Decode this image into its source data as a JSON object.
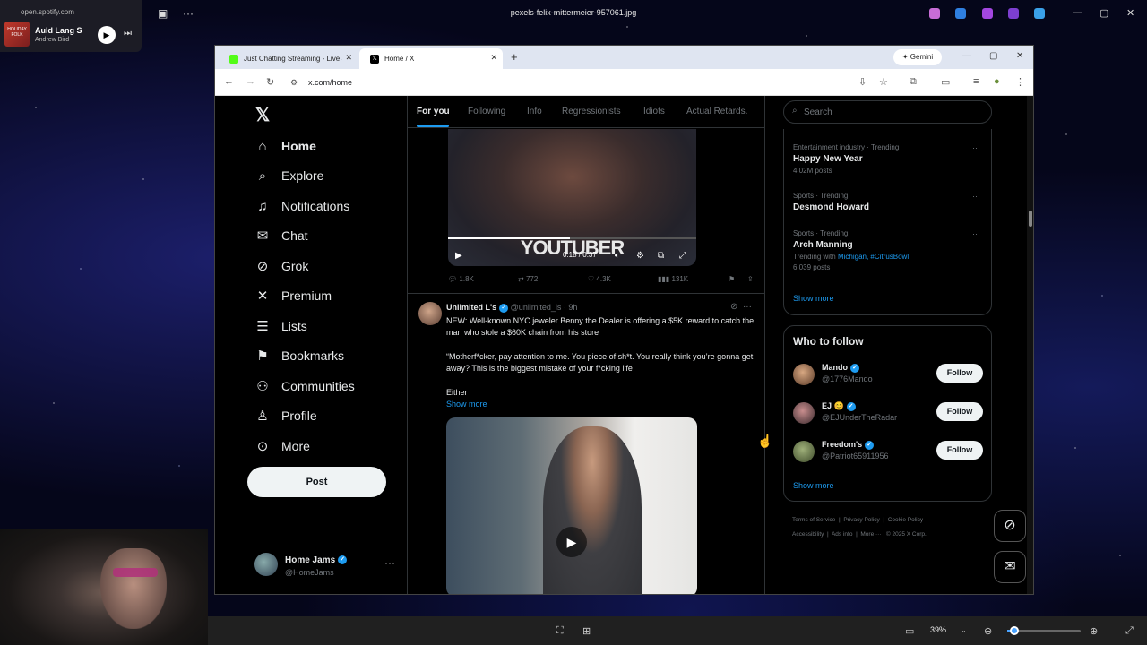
{
  "viewer": {
    "file_name": "pexels-felix-mittermeier-957061.jpg",
    "zoom": "39%"
  },
  "media_widget": {
    "source": "open.spotify.com",
    "album_art_text": "HOLIDAY FOLK",
    "title": "Auld Lang S",
    "artist": "Andrew Bird"
  },
  "browser": {
    "tabs": [
      {
        "label": "Just Chatting Streaming - Live S",
        "icon": "kick-icon",
        "color": "#53fc18"
      },
      {
        "label": "Home / X",
        "icon": "x-icon",
        "color": "#000000"
      }
    ],
    "gemini_label": "Gemini",
    "url": "x.com/home"
  },
  "x": {
    "nav": [
      {
        "id": "home",
        "label": "Home",
        "icon": "home-icon"
      },
      {
        "id": "explore",
        "label": "Explore",
        "icon": "search-icon"
      },
      {
        "id": "notifications",
        "label": "Notifications",
        "icon": "bell-icon"
      },
      {
        "id": "chat",
        "label": "Chat",
        "icon": "mail-icon"
      },
      {
        "id": "grok",
        "label": "Grok",
        "icon": "grok-icon"
      },
      {
        "id": "premium",
        "label": "Premium",
        "icon": "x-premium-icon"
      },
      {
        "id": "lists",
        "label": "Lists",
        "icon": "list-icon"
      },
      {
        "id": "bookmarks",
        "label": "Bookmarks",
        "icon": "bookmark-icon"
      },
      {
        "id": "communities",
        "label": "Communities",
        "icon": "people-icon"
      },
      {
        "id": "profile",
        "label": "Profile",
        "icon": "person-icon"
      },
      {
        "id": "more",
        "label": "More",
        "icon": "more-circle-icon"
      }
    ],
    "post_label": "Post",
    "account": {
      "name": "Home Jams",
      "handle": "@HomeJams"
    },
    "feed_tabs": [
      "For you",
      "Following",
      "Info",
      "Regressionists",
      "Idiots",
      "Actual Retards."
    ],
    "video1": {
      "caption": "YOUTUBER",
      "time": "0:18 / 0:37"
    },
    "post1_actions": {
      "replies": "1.8K",
      "reposts": "772",
      "likes": "4.3K",
      "views": "131K"
    },
    "post2": {
      "name": "Unlimited L's",
      "handle": "@unlimited_ls",
      "time": "· 9h",
      "text1": "NEW: Well-known NYC jeweler Benny the Dealer is offering a $5K reward to catch the man who stole a $60K chain from his store",
      "text2": "“Motherf*cker, pay attention to me. You piece of sh*t. You really think you’re gonna get away? This is the biggest mistake of your f*cking life",
      "text3": "Either",
      "show_more": "Show more"
    },
    "search_placeholder": "Search",
    "trends": [
      {
        "meta": "Entertainment industry · Trending",
        "name": "Happy New Year",
        "sub": "4.02M posts"
      },
      {
        "meta": "Sports · Trending",
        "name": "Desmond Howard",
        "sub": ""
      },
      {
        "meta": "Sports · Trending",
        "name": "Arch Manning",
        "sub_prefix": "Trending with",
        "links": "Michigan, #CitrusBowl",
        "sub": "6,039 posts"
      }
    ],
    "trends_show_more": "Show more",
    "who_to_follow": {
      "title": "Who to follow",
      "users": [
        {
          "name": "Mando",
          "handle": "@1776Mando",
          "button": "Follow"
        },
        {
          "name": "EJ 😊",
          "handle": "@EJUnderTheRadar",
          "button": "Follow"
        },
        {
          "name": "Freedom's",
          "handle": "@Patriot65911956",
          "button": "Follow"
        }
      ],
      "show_more": "Show more"
    },
    "footer": [
      "Terms of Service",
      "Privacy Policy",
      "Cookie Policy",
      "Accessibility",
      "Ads info",
      "More ···",
      "© 2025 X Corp."
    ]
  }
}
